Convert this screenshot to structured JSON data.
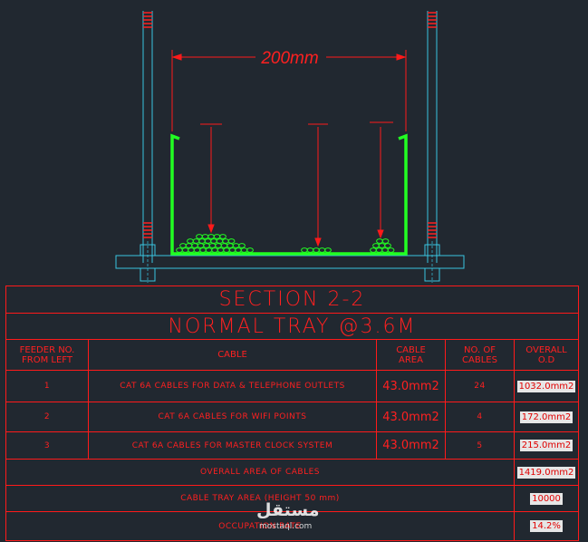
{
  "drawing": {
    "dimension_label": "200mm",
    "colors": {
      "background": "#212830",
      "tray": "#22ff22",
      "rod": "#39c5e0",
      "dimension": "#ff1a1a",
      "text": "#ff2020"
    }
  },
  "table": {
    "title": "SECTION 2-2",
    "subtitle": "NORMAL TRAY @3.6M",
    "headers": {
      "feeder": [
        "FEEDER NO.",
        "FROM LEFT"
      ],
      "cable": "CABLE",
      "area": [
        "CABLE",
        "AREA"
      ],
      "count": [
        "NO. OF",
        "CABLES"
      ],
      "overall": [
        "OVERALL",
        "O.D"
      ]
    },
    "rows": [
      {
        "feeder": "1",
        "cable": "CAT 6A CABLES FOR DATA & TELEPHONE OUTLETS",
        "area": "43.0mm2",
        "count": "24",
        "overall": "1032.0mm2"
      },
      {
        "feeder": "2",
        "cable": "CAT 6A CABLES FOR WIFI POINTS",
        "area": "43.0mm2",
        "count": "4",
        "overall": "172.0mm2"
      },
      {
        "feeder": "3",
        "cable": "CAT 6A CABLES FOR MASTER CLOCK SYSTEM",
        "area": "43.0mm2",
        "count": "5",
        "overall": "215.0mm2"
      }
    ],
    "summary": [
      {
        "label": "OVERALL AREA OF CABLES",
        "value": "1419.0mm2"
      },
      {
        "label": "CABLE TRAY AREA (HEIGHT 50 mm)",
        "value": "10000"
      },
      {
        "label": "OCCUPATION RATE",
        "value": "14.2%"
      }
    ]
  },
  "watermark": {
    "text": "مستقل",
    "subtext": "mostaql.com"
  }
}
